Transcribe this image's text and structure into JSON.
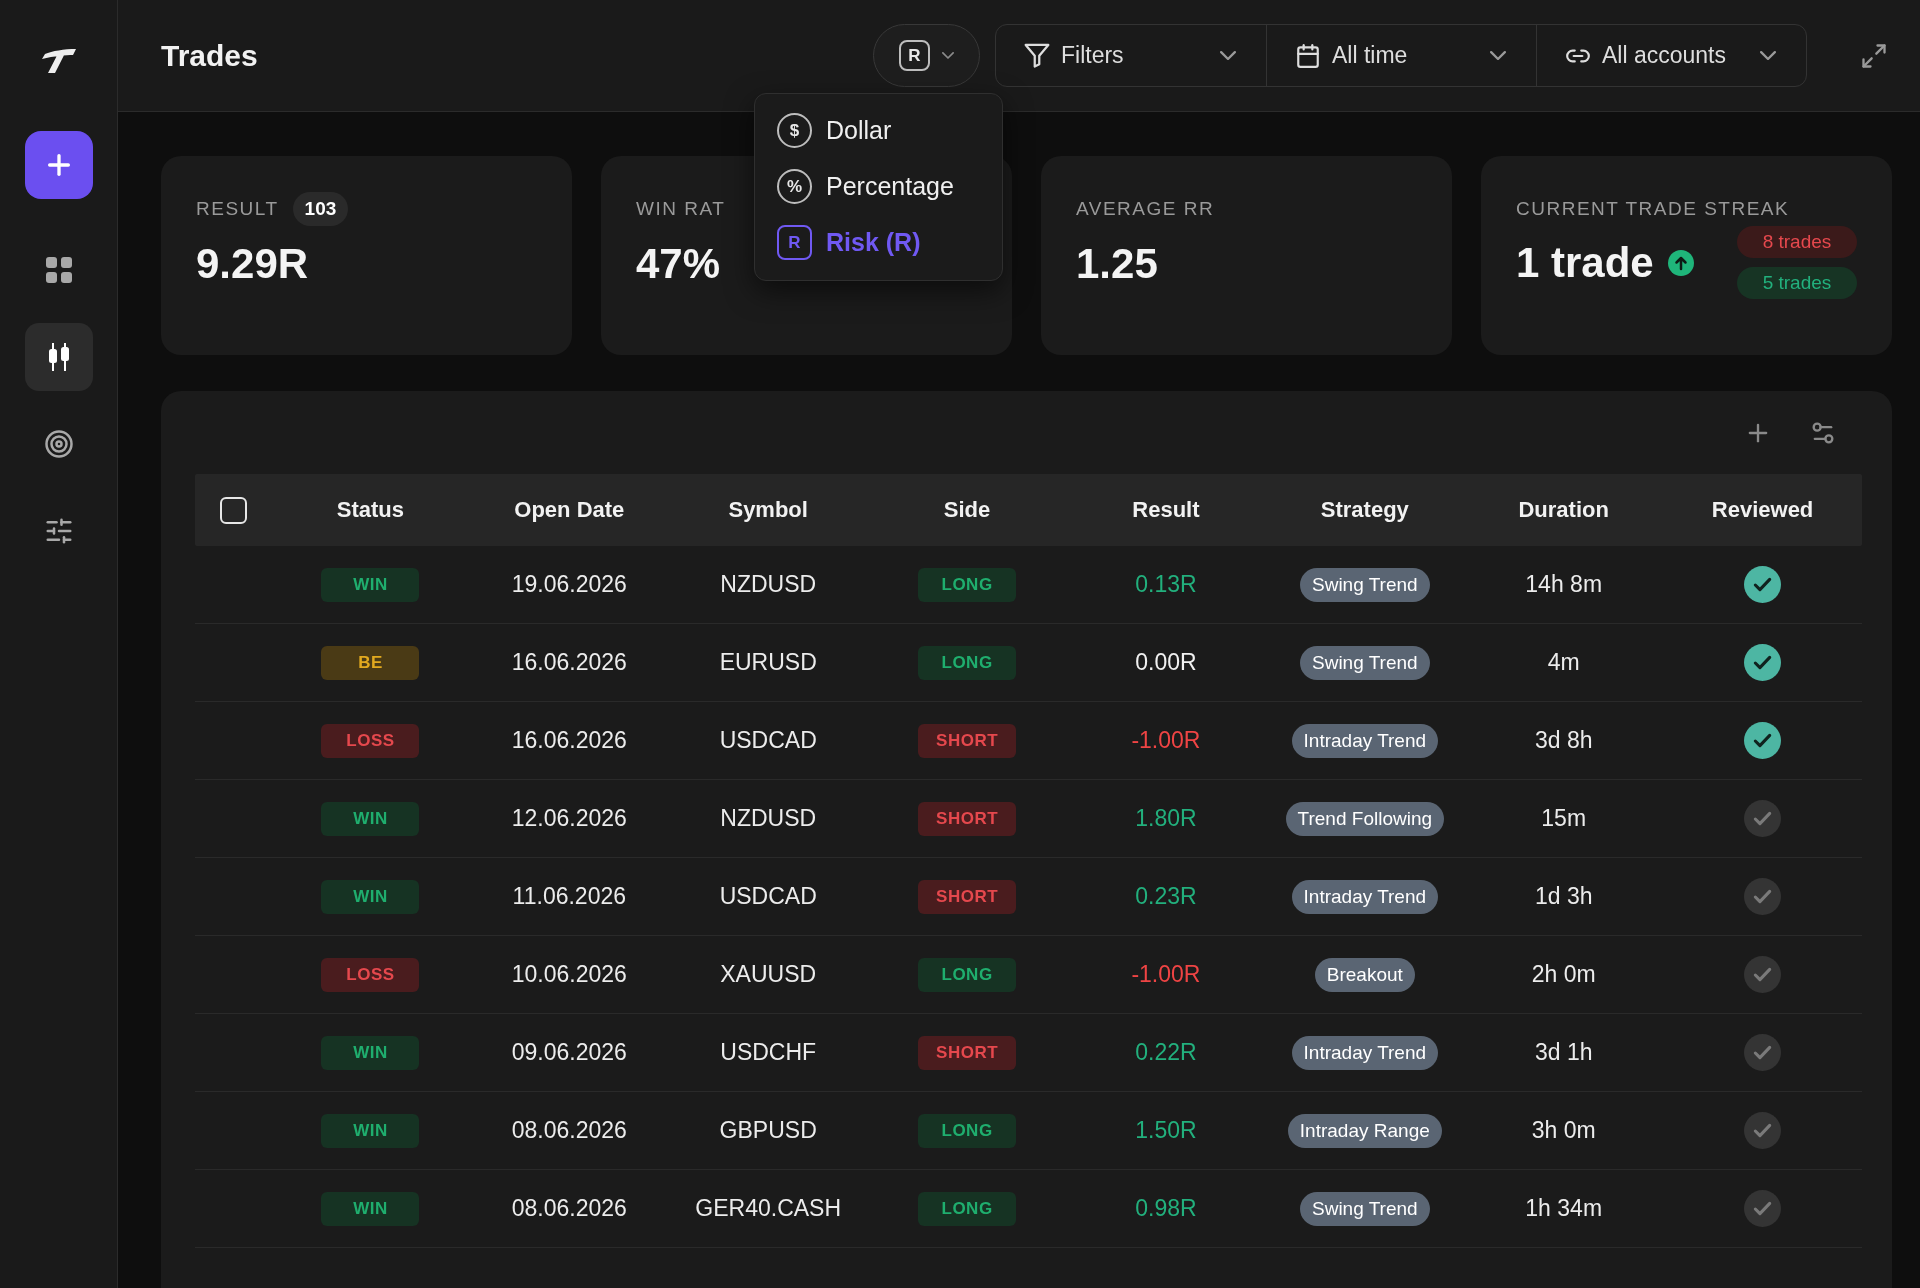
{
  "sidebar": {
    "items": [
      {
        "kind": "dashboard",
        "selected": false
      },
      {
        "kind": "trades",
        "selected": true
      },
      {
        "kind": "goals",
        "selected": false
      },
      {
        "kind": "settings",
        "selected": false
      }
    ]
  },
  "header": {
    "title": "Trades",
    "unit_toggle": {
      "symbol": "R",
      "expanded": true
    },
    "unit_menu": [
      {
        "symbol": "$",
        "label": "Dollar",
        "kind": "circle",
        "selected": false
      },
      {
        "symbol": "%",
        "label": "Percentage",
        "kind": "circle",
        "selected": false
      },
      {
        "symbol": "R",
        "label": "Risk (R)",
        "kind": "square",
        "selected": true
      }
    ],
    "filters": [
      {
        "kind": "filter",
        "label": "Filters"
      },
      {
        "kind": "date",
        "label": "All time"
      },
      {
        "kind": "account",
        "label": "All accounts"
      }
    ]
  },
  "stats": [
    {
      "kind": "count",
      "label": "RESULT",
      "count": "103",
      "value": "9.29R"
    },
    {
      "kind": "plain",
      "label": "WIN RAT",
      "value": "47%"
    },
    {
      "kind": "plain",
      "label": "AVERAGE RR",
      "value": "1.25"
    },
    {
      "kind": "streak",
      "label": "CURRENT TRADE STREAK",
      "value": "1 trade",
      "trend": {
        "kind": "up"
      },
      "streaks": [
        {
          "label": "8 trades",
          "kind": "loss"
        },
        {
          "label": "5 trades",
          "kind": "win"
        }
      ]
    }
  ],
  "table": {
    "select_all": {
      "checked": false
    },
    "columns": [
      "Status",
      "Open Date",
      "Symbol",
      "Side",
      "Result",
      "Strategy",
      "Duration",
      "Reviewed"
    ],
    "rows": [
      {
        "status": {
          "label": "WIN",
          "kind": "win"
        },
        "open_date": "19.06.2026",
        "symbol": "NZDUSD",
        "side": {
          "label": "LONG",
          "kind": "long"
        },
        "result": {
          "text": "0.13R",
          "kind": "positive"
        },
        "strategy": "Swing Trend",
        "duration": "14h 8m",
        "reviewed": true
      },
      {
        "status": {
          "label": "BE",
          "kind": "be"
        },
        "open_date": "16.06.2026",
        "symbol": "EURUSD",
        "side": {
          "label": "LONG",
          "kind": "long"
        },
        "result": {
          "text": "0.00R",
          "kind": "neutral"
        },
        "strategy": "Swing Trend",
        "duration": "4m",
        "reviewed": true
      },
      {
        "status": {
          "label": "LOSS",
          "kind": "loss"
        },
        "open_date": "16.06.2026",
        "symbol": "USDCAD",
        "side": {
          "label": "SHORT",
          "kind": "short"
        },
        "result": {
          "text": "-1.00R",
          "kind": "negative"
        },
        "strategy": "Intraday Trend",
        "duration": "3d 8h",
        "reviewed": true
      },
      {
        "status": {
          "label": "WIN",
          "kind": "win"
        },
        "open_date": "12.06.2026",
        "symbol": "NZDUSD",
        "side": {
          "label": "SHORT",
          "kind": "short"
        },
        "result": {
          "text": "1.80R",
          "kind": "positive"
        },
        "strategy": "Trend Following",
        "duration": "15m",
        "reviewed": false
      },
      {
        "status": {
          "label": "WIN",
          "kind": "win"
        },
        "open_date": "11.06.2026",
        "symbol": "USDCAD",
        "side": {
          "label": "SHORT",
          "kind": "short"
        },
        "result": {
          "text": "0.23R",
          "kind": "positive"
        },
        "strategy": "Intraday Trend",
        "duration": "1d 3h",
        "reviewed": false
      },
      {
        "status": {
          "label": "LOSS",
          "kind": "loss"
        },
        "open_date": "10.06.2026",
        "symbol": "XAUUSD",
        "side": {
          "label": "LONG",
          "kind": "long"
        },
        "result": {
          "text": "-1.00R",
          "kind": "negative"
        },
        "strategy": "Breakout",
        "duration": "2h 0m",
        "reviewed": false
      },
      {
        "status": {
          "label": "WIN",
          "kind": "win"
        },
        "open_date": "09.06.2026",
        "symbol": "USDCHF",
        "side": {
          "label": "SHORT",
          "kind": "short"
        },
        "result": {
          "text": "0.22R",
          "kind": "positive"
        },
        "strategy": "Intraday Trend",
        "duration": "3d 1h",
        "reviewed": false
      },
      {
        "status": {
          "label": "WIN",
          "kind": "win"
        },
        "open_date": "08.06.2026",
        "symbol": "GBPUSD",
        "side": {
          "label": "LONG",
          "kind": "long"
        },
        "result": {
          "text": "1.50R",
          "kind": "positive"
        },
        "strategy": "Intraday Range",
        "duration": "3h 0m",
        "reviewed": false
      },
      {
        "status": {
          "label": "WIN",
          "kind": "win"
        },
        "open_date": "08.06.2026",
        "symbol": "GER40.CASH",
        "side": {
          "label": "LONG",
          "kind": "long"
        },
        "result": {
          "text": "0.98R",
          "kind": "positive"
        },
        "strategy": "Swing Trend",
        "duration": "1h 34m",
        "reviewed": false
      }
    ]
  }
}
